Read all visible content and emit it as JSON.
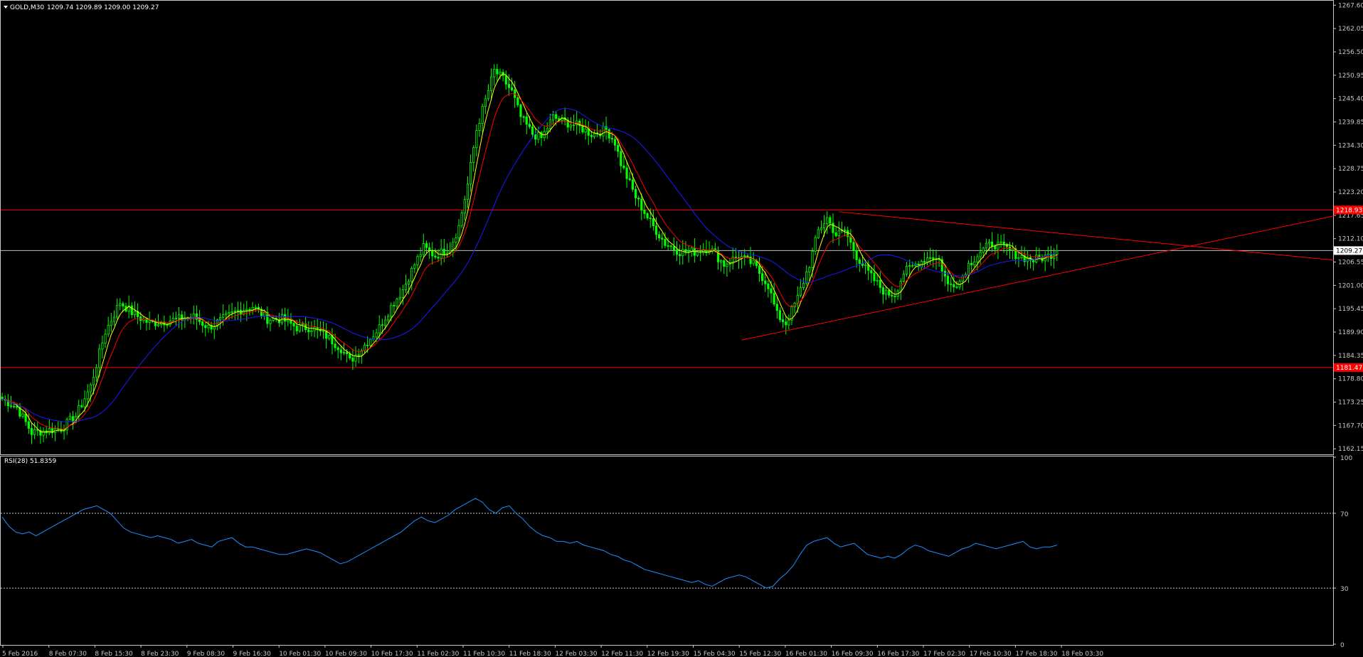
{
  "header": {
    "symbol_text": "GOLD,M30",
    "ohlc_text": "1209.74 1209.89 1209.00 1209.27",
    "dropdown_icon": "triangle-down-icon"
  },
  "rsi_header": {
    "text": "RSI(28) 51.8359"
  },
  "colors": {
    "background": "#000000",
    "candle": "#00ff00",
    "ma_fast": "#ffff00",
    "ma_mid": "#ff0000",
    "ma_slow": "#1a1aff",
    "trendline": "#ff0000",
    "hline": "#ff0000",
    "current_price_line": "#c0c0c0",
    "rsi_line": "#1e90ff",
    "axis": "#c8c8c8"
  },
  "chart_data": [
    {
      "type": "candlestick",
      "title": "GOLD,M30",
      "ylim": [
        1161.0,
        1268.5
      ],
      "y_ticks": [
        "1267.60",
        "1262.05",
        "1256.50",
        "1250.95",
        "1245.40",
        "1239.85",
        "1234.30",
        "1228.75",
        "1223.20",
        "1217.65",
        "1212.10",
        "1206.55",
        "1201.00",
        "1195.45",
        "1189.90",
        "1184.35",
        "1178.80",
        "1173.25",
        "1167.70",
        "1162.15"
      ],
      "x_ticks": [
        "5 Feb 2016",
        "8 Feb 07:30",
        "8 Feb 15:30",
        "8 Feb 23:30",
        "9 Feb 08:30",
        "9 Feb 16:30",
        "10 Feb 01:30",
        "10 Feb 09:30",
        "10 Feb 17:30",
        "11 Feb 02:30",
        "11 Feb 10:30",
        "11 Feb 18:30",
        "12 Feb 03:30",
        "12 Feb 11:30",
        "12 Feb 19:30",
        "15 Feb 04:30",
        "15 Feb 12:30",
        "16 Feb 01:30",
        "16 Feb 09:30",
        "16 Feb 17:30",
        "17 Feb 02:30",
        "17 Feb 10:30",
        "17 Feb 18:30",
        "18 Feb 03:30"
      ],
      "price_path": [
        [
          0,
          1174
        ],
        [
          5,
          1172
        ],
        [
          10,
          1166
        ],
        [
          15,
          1166.5
        ],
        [
          20,
          1167
        ],
        [
          25,
          1170
        ],
        [
          30,
          1177
        ],
        [
          35,
          1190
        ],
        [
          40,
          1197
        ],
        [
          45,
          1194
        ],
        [
          50,
          1192
        ],
        [
          55,
          1192.5
        ],
        [
          60,
          1193
        ],
        [
          65,
          1193.5
        ],
        [
          70,
          1191
        ],
        [
          75,
          1193
        ],
        [
          80,
          1195
        ],
        [
          85,
          1196
        ],
        [
          90,
          1193
        ],
        [
          95,
          1193
        ],
        [
          100,
          1191
        ],
        [
          105,
          1191
        ],
        [
          110,
          1189
        ],
        [
          115,
          1186
        ],
        [
          118,
          1183
        ],
        [
          122,
          1186
        ],
        [
          128,
          1191
        ],
        [
          132,
          1196
        ],
        [
          136,
          1200
        ],
        [
          140,
          1206
        ],
        [
          143,
          1210
        ],
        [
          147,
          1208
        ],
        [
          152,
          1210
        ],
        [
          155,
          1215
        ],
        [
          158,
          1225
        ],
        [
          161,
          1238
        ],
        [
          164,
          1245
        ],
        [
          167,
          1252
        ],
        [
          170,
          1250
        ],
        [
          173,
          1247
        ],
        [
          176,
          1241
        ],
        [
          180,
          1237
        ],
        [
          183,
          1236
        ],
        [
          187,
          1241
        ],
        [
          190,
          1240
        ],
        [
          195,
          1239
        ],
        [
          200,
          1237
        ],
        [
          205,
          1238
        ],
        [
          208,
          1235
        ],
        [
          210,
          1230
        ],
        [
          215,
          1222
        ],
        [
          220,
          1216
        ],
        [
          225,
          1211
        ],
        [
          230,
          1209
        ],
        [
          235,
          1209
        ],
        [
          240,
          1210
        ],
        [
          245,
          1206
        ],
        [
          250,
          1208
        ],
        [
          255,
          1206
        ],
        [
          260,
          1201
        ],
        [
          263,
          1194
        ],
        [
          266,
          1192
        ],
        [
          270,
          1198
        ],
        [
          274,
          1206
        ],
        [
          277,
          1214
        ],
        [
          280,
          1217
        ],
        [
          283,
          1213
        ],
        [
          286,
          1214
        ],
        [
          290,
          1208
        ],
        [
          295,
          1203
        ],
        [
          300,
          1199
        ],
        [
          303,
          1199
        ],
        [
          306,
          1204
        ],
        [
          310,
          1206
        ],
        [
          315,
          1208
        ],
        [
          318,
          1207
        ],
        [
          321,
          1201
        ],
        [
          325,
          1202
        ],
        [
          328,
          1206
        ],
        [
          332,
          1209
        ],
        [
          336,
          1211
        ],
        [
          340,
          1210
        ],
        [
          345,
          1208
        ],
        [
          350,
          1207
        ],
        [
          355,
          1208
        ],
        [
          358,
          1209.27
        ]
      ],
      "overlays": [
        {
          "name": "",
          "kind": "moving_average_fast",
          "color": "#ffff00"
        },
        {
          "name": "",
          "kind": "moving_average_mid",
          "color": "#ff0000"
        },
        {
          "name": "",
          "kind": "moving_average_slow",
          "color": "#1a1aff"
        }
      ],
      "horizontal_levels": [
        {
          "value": 1218.93,
          "label": "1218.93",
          "color": "#ff0000"
        },
        {
          "value": 1181.47,
          "label": "1181.47",
          "color": "#ff0000"
        },
        {
          "value": 1209.27,
          "label": "1209.27",
          "color": "#c0c0c0",
          "current_price": true
        }
      ],
      "trendlines": [
        {
          "from": [
            251,
            1188
          ],
          "to": [
            452,
            1217.5
          ]
        },
        {
          "from": [
            284,
            1218.5
          ],
          "to": [
            452,
            1207
          ]
        }
      ]
    },
    {
      "type": "line",
      "title": "RSI(28) 51.8359",
      "ylim": [
        0,
        100
      ],
      "y_ticks": [
        "100",
        "70",
        "30",
        "0"
      ],
      "levels": [
        70,
        30
      ],
      "values": [
        68,
        63,
        60,
        59,
        60,
        58,
        60,
        62,
        64,
        66,
        68,
        70,
        72,
        73,
        74,
        72,
        70,
        66,
        62,
        60,
        59,
        58,
        57,
        58,
        57,
        56,
        54,
        55,
        56,
        54,
        53,
        52,
        55,
        56,
        57,
        54,
        52,
        52,
        51,
        50,
        49,
        48,
        48,
        49,
        50,
        51,
        50,
        49,
        47,
        45,
        43,
        44,
        46,
        48,
        50,
        52,
        54,
        56,
        58,
        60,
        63,
        66,
        68,
        66,
        65,
        67,
        69,
        72,
        74,
        76,
        78,
        76,
        72,
        70,
        73,
        74,
        70,
        67,
        63,
        60,
        58,
        57,
        55,
        55,
        54,
        55,
        53,
        52,
        51,
        50,
        48,
        47,
        45,
        44,
        42,
        40,
        39,
        38,
        37,
        36,
        35,
        34,
        33,
        34,
        32,
        31,
        33,
        35,
        36,
        37,
        36,
        34,
        32,
        30,
        31,
        35,
        38,
        42,
        48,
        53,
        55,
        56,
        57,
        54,
        52,
        53,
        54,
        51,
        48,
        47,
        46,
        47,
        46,
        48,
        51,
        53,
        52,
        50,
        49,
        48,
        47,
        49,
        51,
        52,
        54,
        53,
        52,
        51,
        52,
        53,
        54,
        55,
        52,
        51,
        52,
        52,
        53
      ]
    }
  ]
}
